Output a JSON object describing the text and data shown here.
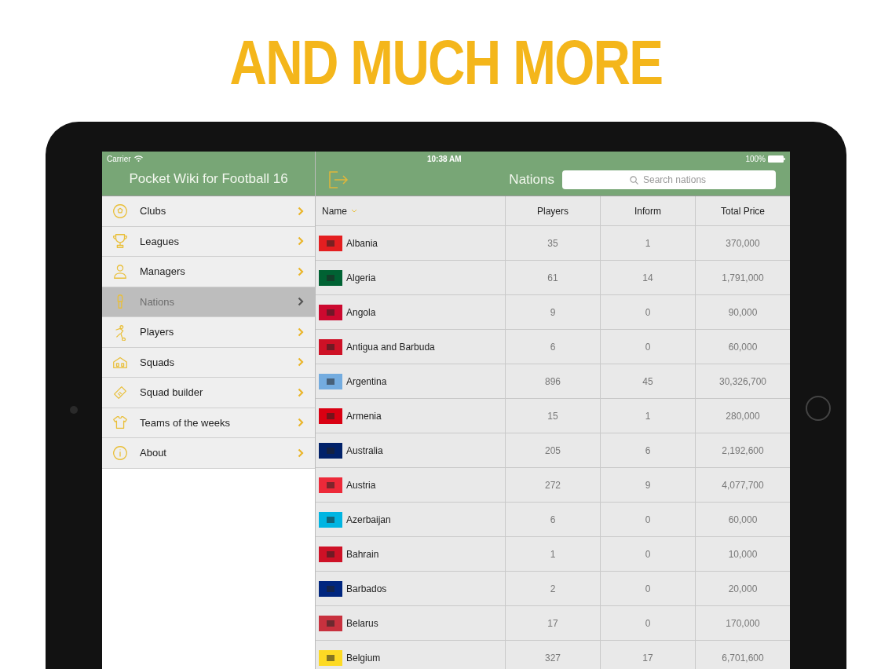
{
  "headline": "AND MUCH MORE",
  "status_bar": {
    "carrier": "Carrier",
    "time": "10:38 AM",
    "battery": "100%"
  },
  "sidebar": {
    "title": "Pocket Wiki for Football 16",
    "items": [
      {
        "label": "Clubs",
        "selected": false
      },
      {
        "label": "Leagues",
        "selected": false
      },
      {
        "label": "Managers",
        "selected": false
      },
      {
        "label": "Nations",
        "selected": true
      },
      {
        "label": "Players",
        "selected": false
      },
      {
        "label": "Squads",
        "selected": false
      },
      {
        "label": "Squad builder",
        "selected": false
      },
      {
        "label": "Teams of the weeks",
        "selected": false
      },
      {
        "label": "About",
        "selected": false
      }
    ]
  },
  "nav": {
    "title": "Nations",
    "search": {
      "placeholder": "Search nations"
    }
  },
  "table": {
    "columns": [
      "Name",
      "Players",
      "Inform",
      "Total Price"
    ],
    "rows": [
      {
        "name": "Albania",
        "players": "35",
        "inform": "1",
        "total_price": "370,000",
        "color": "#e41e20"
      },
      {
        "name": "Algeria",
        "players": "61",
        "inform": "14",
        "total_price": "1,791,000",
        "color": "#006233"
      },
      {
        "name": "Angola",
        "players": "9",
        "inform": "0",
        "total_price": "90,000",
        "color": "#cc092f"
      },
      {
        "name": "Antigua and Barbuda",
        "players": "6",
        "inform": "0",
        "total_price": "60,000",
        "color": "#ce1126"
      },
      {
        "name": "Argentina",
        "players": "896",
        "inform": "45",
        "total_price": "30,326,700",
        "color": "#74acdf"
      },
      {
        "name": "Armenia",
        "players": "15",
        "inform": "1",
        "total_price": "280,000",
        "color": "#d90012"
      },
      {
        "name": "Australia",
        "players": "205",
        "inform": "6",
        "total_price": "2,192,600",
        "color": "#012169"
      },
      {
        "name": "Austria",
        "players": "272",
        "inform": "9",
        "total_price": "4,077,700",
        "color": "#ed2939"
      },
      {
        "name": "Azerbaijan",
        "players": "6",
        "inform": "0",
        "total_price": "60,000",
        "color": "#00b5e2"
      },
      {
        "name": "Bahrain",
        "players": "1",
        "inform": "0",
        "total_price": "10,000",
        "color": "#ce1126"
      },
      {
        "name": "Barbados",
        "players": "2",
        "inform": "0",
        "total_price": "20,000",
        "color": "#00267f"
      },
      {
        "name": "Belarus",
        "players": "17",
        "inform": "0",
        "total_price": "170,000",
        "color": "#c8313e"
      },
      {
        "name": "Belgium",
        "players": "327",
        "inform": "17",
        "total_price": "6,701,600",
        "color": "#fdda24"
      }
    ]
  }
}
